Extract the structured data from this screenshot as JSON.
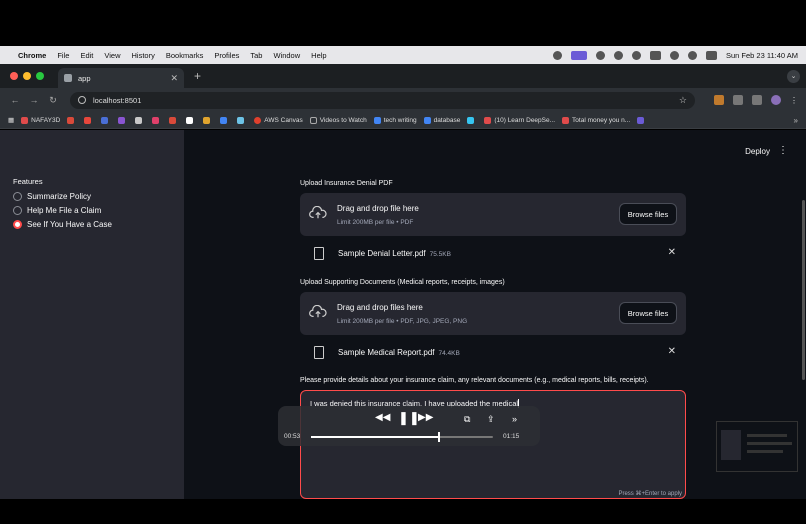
{
  "menubar": {
    "app_name": "Chrome",
    "items": [
      "File",
      "Edit",
      "View",
      "History",
      "Bookmarks",
      "Profiles",
      "Tab",
      "Window",
      "Help"
    ],
    "clock": "Sun Feb 23  11:40 AM"
  },
  "tab": {
    "title": "app",
    "new_tab": "+"
  },
  "address": {
    "url": "localhost:8501"
  },
  "bookmarks": [
    {
      "label": "NAFAY3D",
      "color": "#e04b4b"
    },
    {
      "label": "",
      "color": "#d94a3a"
    },
    {
      "label": "",
      "color": "#e7473c"
    },
    {
      "label": "",
      "color": "#4a6fd6"
    },
    {
      "label": "",
      "color": "#8a55d1"
    },
    {
      "label": "",
      "color": "#c8c8c8"
    },
    {
      "label": "",
      "color": "#e0406a"
    },
    {
      "label": "",
      "color": "#d94a3a"
    },
    {
      "label": "",
      "color": "#ffffff"
    },
    {
      "label": "",
      "color": "#e1a52e"
    },
    {
      "label": "",
      "color": "#4285f4"
    },
    {
      "label": "",
      "color": "#6dc3e6"
    },
    {
      "label": "AWS Canvas",
      "color": "#e0402d"
    },
    {
      "label": "Videos to Watch",
      "color": "#aaaaaa"
    },
    {
      "label": "tech writing",
      "color": "#4285f4"
    },
    {
      "label": "database",
      "color": "#4285f4"
    },
    {
      "label": "",
      "color": "#36c5f0"
    },
    {
      "label": "(10) Learn DeepSe...",
      "color": "#e04b4b"
    },
    {
      "label": "Total money you n...",
      "color": "#e04b4b"
    },
    {
      "label": "",
      "color": "#6b5bd6"
    }
  ],
  "sidebar": {
    "group_title": "Features",
    "options": [
      "Summarize Policy",
      "Help Me File a Claim",
      "See If You Have a Case"
    ],
    "selected_index": 2
  },
  "header": {
    "deploy": "Deploy",
    "menu": "⋮"
  },
  "upload_pdf": {
    "label": "Upload Insurance Denial PDF",
    "title": "Drag and drop file here",
    "limit": "Limit 200MB per file • PDF",
    "browse": "Browse files",
    "file_name": "Sample Denial Letter.pdf",
    "file_size": "75.5KB"
  },
  "upload_docs": {
    "label": "Upload Supporting Documents (Medical reports, receipts, images)",
    "title": "Drag and drop files here",
    "limit": "Limit 200MB per file • PDF, JPG, JPEG, PNG",
    "browse": "Browse files",
    "file_name": "Sample Medical Report.pdf",
    "file_size": "74.4KB"
  },
  "details": {
    "label": "Please provide details about your insurance claim, any relevant documents (e.g., medical reports, bills, receipts).",
    "value": "I was denied this insurance claim. I have uploaded the medical",
    "hint": "Press ⌘+Enter to apply"
  },
  "player": {
    "elapsed": "00:53",
    "total": "01:15",
    "progress": 0.7
  }
}
